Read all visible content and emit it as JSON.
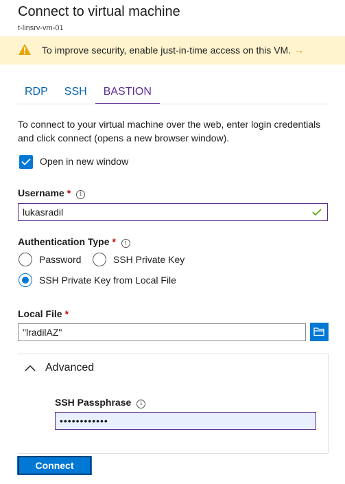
{
  "header": {
    "title": "Connect to virtual machine",
    "subtitle": "t-linsrv-vm-01"
  },
  "banner": {
    "text": "To improve security, enable just-in-time access on this VM.",
    "arrow": "→",
    "icon": "warning-icon"
  },
  "tabs": [
    {
      "label": "RDP",
      "active": false
    },
    {
      "label": "SSH",
      "active": false
    },
    {
      "label": "BASTION",
      "active": true
    }
  ],
  "description": "To connect to your virtual machine over the web, enter login credentials and click connect (opens a new browser window).",
  "open_new_window": {
    "label": "Open in new window",
    "checked": true
  },
  "username": {
    "label": "Username",
    "required": "*",
    "info": "i",
    "value": "lukasradil"
  },
  "auth_type": {
    "label": "Authentication Type",
    "required": "*",
    "info": "i",
    "options": [
      {
        "label": "Password",
        "selected": false
      },
      {
        "label": "SSH Private Key",
        "selected": false
      },
      {
        "label": "SSH Private Key from Local File",
        "selected": true
      }
    ]
  },
  "local_file": {
    "label": "Local File",
    "required": "*",
    "value": "\"lradilAZ\"",
    "button_icon": "folder-open-icon"
  },
  "advanced": {
    "label": "Advanced",
    "expanded": true,
    "passphrase": {
      "label": "SSH Passphrase",
      "info": "i",
      "value": "••••••••••••"
    }
  },
  "connect_button": {
    "label": "Connect"
  },
  "colors": {
    "accent": "#0078d4",
    "tab_active": "#5c2d91",
    "warning_bg": "#fff4ce",
    "required": "#c00000",
    "valid_check": "#57a300"
  }
}
